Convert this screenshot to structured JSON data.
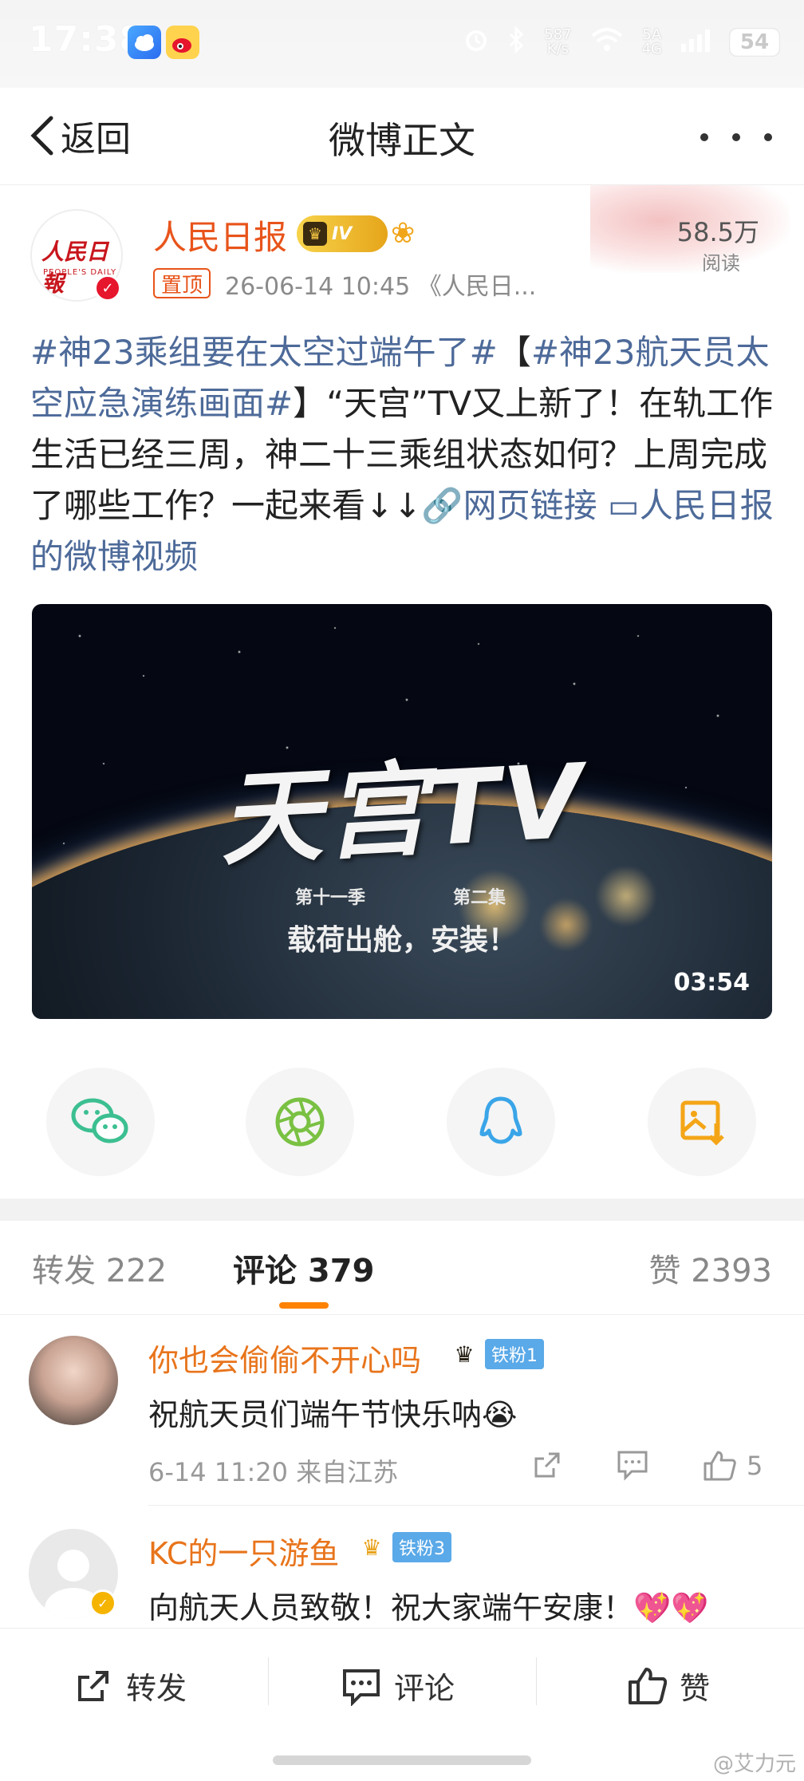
{
  "status_bar": {
    "time": "17:38",
    "net_speed": "587\nK/s",
    "network": "5A\n4G",
    "battery": "54"
  },
  "nav": {
    "back_label": "返回",
    "title": "微博正文"
  },
  "post": {
    "author": "人民日报",
    "level_badge": "IV",
    "pinned_label": "置顶",
    "meta": "26-06-14 10:45 《人民日...",
    "read_count": "58.5万",
    "read_label": "阅读",
    "avatar_logo": "人民日報",
    "avatar_sub": "PEOPLE'S DAILY",
    "text_parts": {
      "topic1": "#神23乘组要在太空过端午了#",
      "bracket_open": "【",
      "topic2": "#神23航天员太空应急演练画面#",
      "body": "】“天宫”TV又上新了！在轨工作生活已经三周，神二十三乘组状态如何？上周完成了哪些工作？一起来看↓↓",
      "link1": "🔗网页链接",
      "link2": "▭人民日报的微博视频"
    },
    "video": {
      "title": "天宫TV",
      "season": "第十一季",
      "episode": "第二集",
      "subtitle": "载荷出舱，安装！",
      "duration": "03:54"
    }
  },
  "share_icons": [
    "wechat-icon",
    "moments-icon",
    "qq-icon",
    "save-image-icon"
  ],
  "tabs": {
    "forward": "转发 222",
    "comments": "评论 379",
    "likes": "赞 2393"
  },
  "comments": [
    {
      "name": "你也会偷偷不开心吗",
      "badge": "铁粉1",
      "text": "祝航天员们端午节快乐呐😭",
      "meta": "6-14 11:20 来自江苏",
      "likes": "5"
    },
    {
      "name": "KC的一只游鱼",
      "badge": "铁粉3",
      "text": "向航天人员致敬！祝大家端午安康！💖💖"
    }
  ],
  "bottom_bar": {
    "forward": "转发",
    "comment": "评论",
    "like": "赞"
  },
  "watermark": "@艾力元",
  "colors": {
    "accent_orange": "#ff8200",
    "name_orange": "#e8541b",
    "topic_blue": "#4d6a99",
    "fan_badge_blue": "#5aa9e8"
  }
}
